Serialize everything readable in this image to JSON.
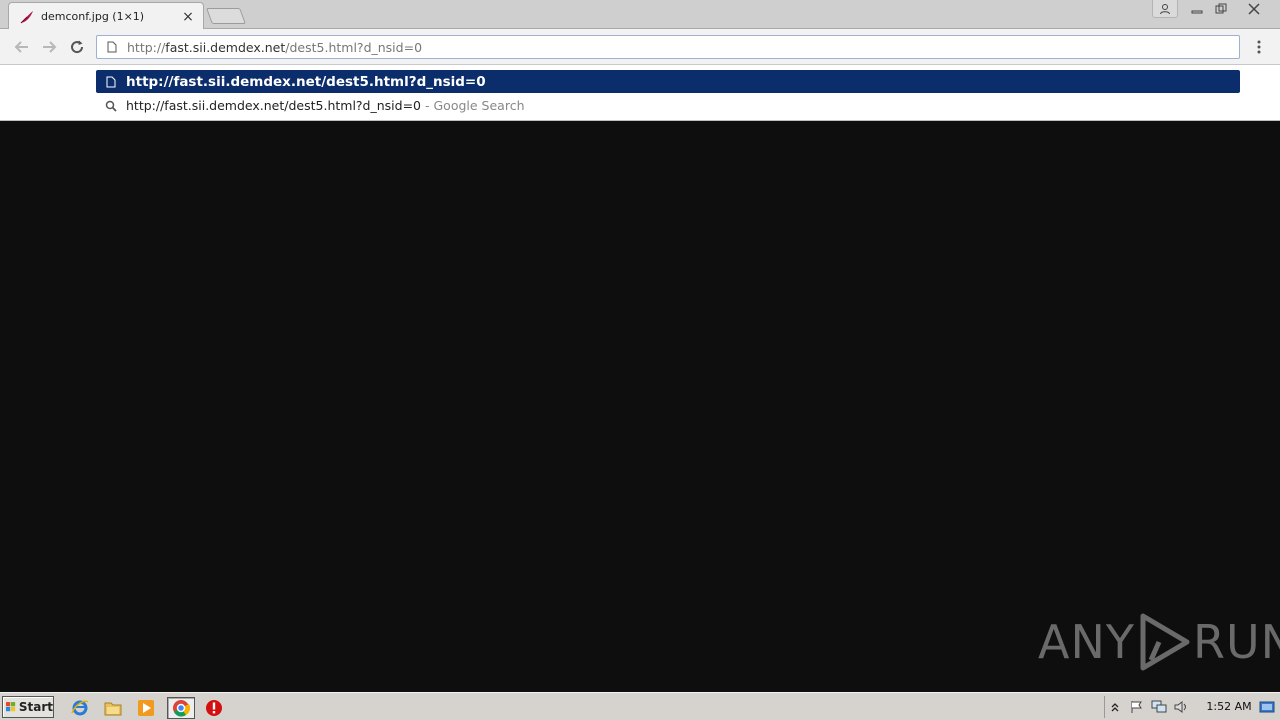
{
  "tab": {
    "title": "demconf.jpg (1×1)",
    "close_icon": "close-icon",
    "favicon": "feather-icon"
  },
  "omnibox": {
    "url_prefix": "http://",
    "url_host": "fast.sii.demdex.net",
    "url_path": "/dest5.html?d_nsid=0"
  },
  "suggestions": [
    {
      "text": "http://fast.sii.demdex.net/dest5.html?d_nsid=0",
      "suffix": "",
      "icon": "page-icon",
      "selected": true
    },
    {
      "text": "http://fast.sii.demdex.net/dest5.html?d_nsid=0",
      "suffix": "- Google Search",
      "icon": "search-icon",
      "selected": false
    }
  ],
  "watermark": {
    "left": "ANY",
    "right": "RUN"
  },
  "taskbar": {
    "start_label": "Start",
    "clock": "1:52 AM"
  },
  "colors": {
    "selected_suggestion": "#0c2d6b",
    "page_background": "#0e0e0e",
    "taskbar": "#d6d3ce"
  }
}
